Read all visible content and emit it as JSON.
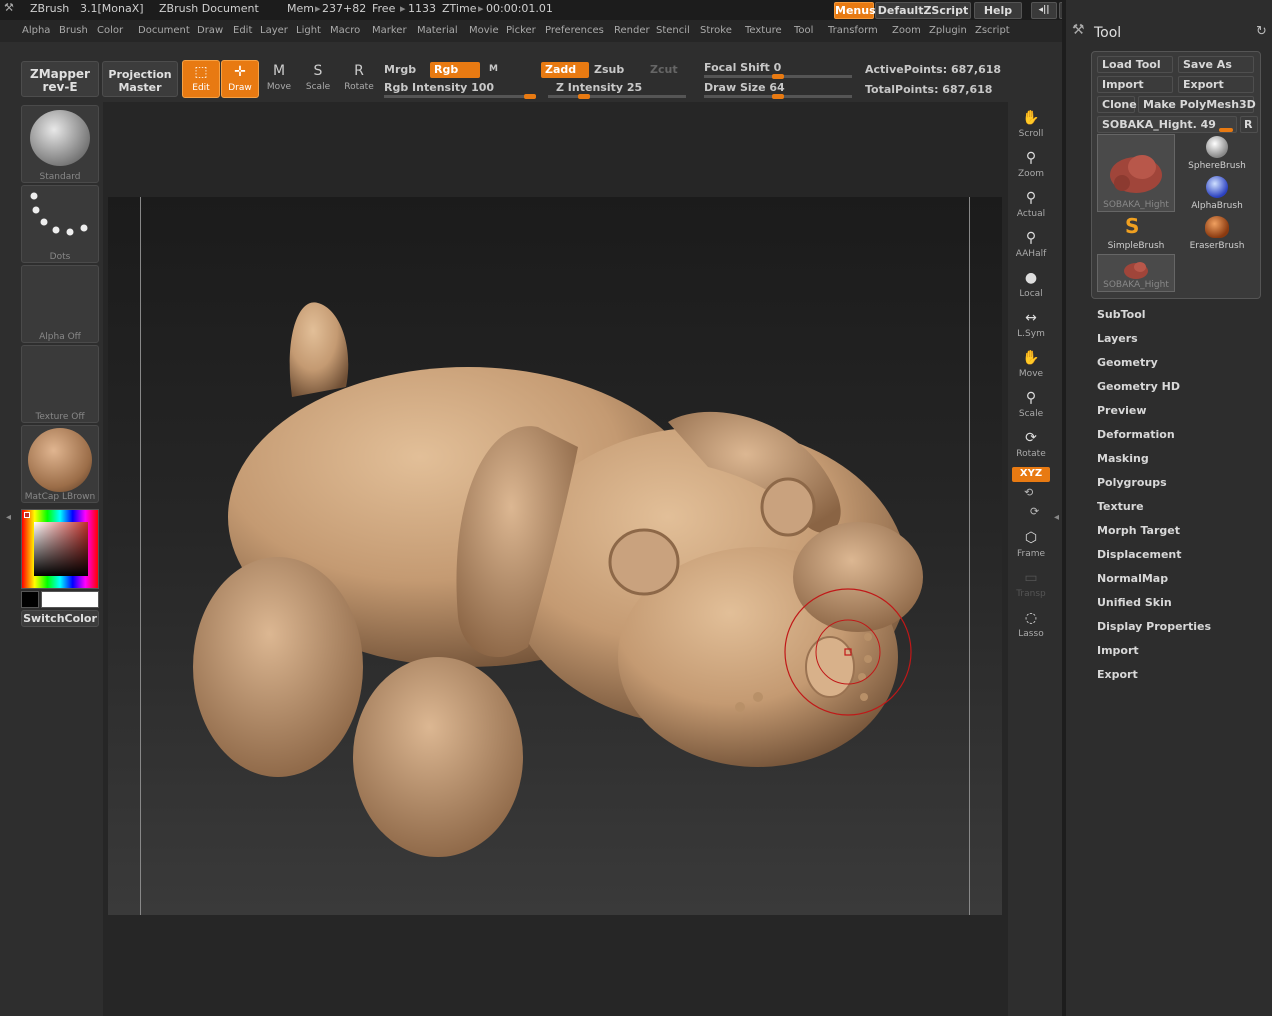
{
  "title_bar": {
    "app": "ZBrush",
    "version": "3.1[MonaX]",
    "document": "ZBrush Document",
    "mem_label": "Mem",
    "mem_value": "237+82",
    "free_label": "Free",
    "free_value": "1133",
    "ztime_label": "ZTime",
    "ztime_value": "00:00:01.01"
  },
  "top_buttons": {
    "menus": "Menus",
    "script": "DefaultZScript",
    "help": "Help"
  },
  "menus": [
    "Alpha",
    "Brush",
    "Color",
    "Document",
    "Draw",
    "Edit",
    "Layer",
    "Light",
    "Macro",
    "Marker",
    "Material",
    "Movie",
    "Picker",
    "Preferences",
    "Render",
    "Stencil",
    "Stroke",
    "Texture",
    "Tool",
    "Transform",
    "Zoom",
    "Zplugin",
    "Zscript"
  ],
  "shelf": {
    "zmapper_line1": "ZMapper",
    "zmapper_line2": "rev-E",
    "projection_line1": "Projection",
    "projection_line2": "Master",
    "tools": [
      {
        "label": "Edit",
        "icon": "edit-icon"
      },
      {
        "label": "Draw",
        "icon": "draw-icon"
      },
      {
        "label": "Move",
        "letter": "M"
      },
      {
        "label": "Scale",
        "letter": "S"
      },
      {
        "label": "Rotate",
        "letter": "R"
      }
    ],
    "mrgb": "Mrgb",
    "rgb": "Rgb",
    "m": "M",
    "rgb_intensity": "Rgb Intensity 100",
    "rgb_intensity_value": 100,
    "zadd": "Zadd",
    "zsub": "Zsub",
    "zcut": "Zcut",
    "z_intensity": "Z Intensity 25",
    "z_intensity_value": 25,
    "focal_shift": "Focal Shift 0",
    "focal_shift_value": 0,
    "draw_size": "Draw Size 64",
    "draw_size_value": 64,
    "active_points": "ActivePoints: 687,618",
    "total_points": "TotalPoints: 687,618"
  },
  "left": {
    "brush_label": "Standard",
    "stroke_label": "Dots",
    "alpha_label": "Alpha Off",
    "texture_label": "Texture Off",
    "material_label": "MatCap LBrown",
    "switch_color": "SwitchColor"
  },
  "right_shelf": [
    {
      "label": "Scroll",
      "icon": "hand-icon"
    },
    {
      "label": "Zoom",
      "icon": "zoom-icon"
    },
    {
      "label": "Actual",
      "icon": "actual-icon"
    },
    {
      "label": "AAHalf",
      "icon": "aahalf-icon"
    },
    {
      "label": "Local",
      "icon": "local-icon"
    },
    {
      "label": "L.Sym",
      "icon": "lsym-icon"
    },
    {
      "label": "Move",
      "icon": "move-icon"
    },
    {
      "label": "Scale",
      "icon": "scale-icon"
    },
    {
      "label": "Rotate",
      "icon": "rotate-icon"
    },
    {
      "label": "XYZ",
      "icon": "xyz-icon"
    },
    {
      "label": "Frame",
      "icon": "frame-icon"
    },
    {
      "label": "Transp",
      "icon": "transp-icon"
    },
    {
      "label": "Lasso",
      "icon": "lasso-icon"
    }
  ],
  "tool_panel": {
    "title": "Tool",
    "load_tool": "Load Tool",
    "save_as": "Save As",
    "import": "Import",
    "export": "Export",
    "clone": "Clone",
    "make_polymesh": "Make PolyMesh3D",
    "active_tool": "SOBAKA_Hight. 49",
    "r": "R",
    "brushes": [
      "SOBAKA_Hight",
      "SphereBrush",
      "AlphaBrush",
      "SimpleBrush",
      "EraserBrush",
      "SOBAKA_Hight"
    ],
    "subpalettes": [
      "SubTool",
      "Layers",
      "Geometry",
      "Geometry HD",
      "Preview",
      "Deformation",
      "Masking",
      "Polygroups",
      "Texture",
      "Morph Target",
      "Displacement",
      "NormalMap",
      "Unified Skin",
      "Display Properties",
      "Import",
      "Export"
    ]
  },
  "colors": {
    "accent": "#e87a12",
    "clay": "#c9a27e"
  }
}
